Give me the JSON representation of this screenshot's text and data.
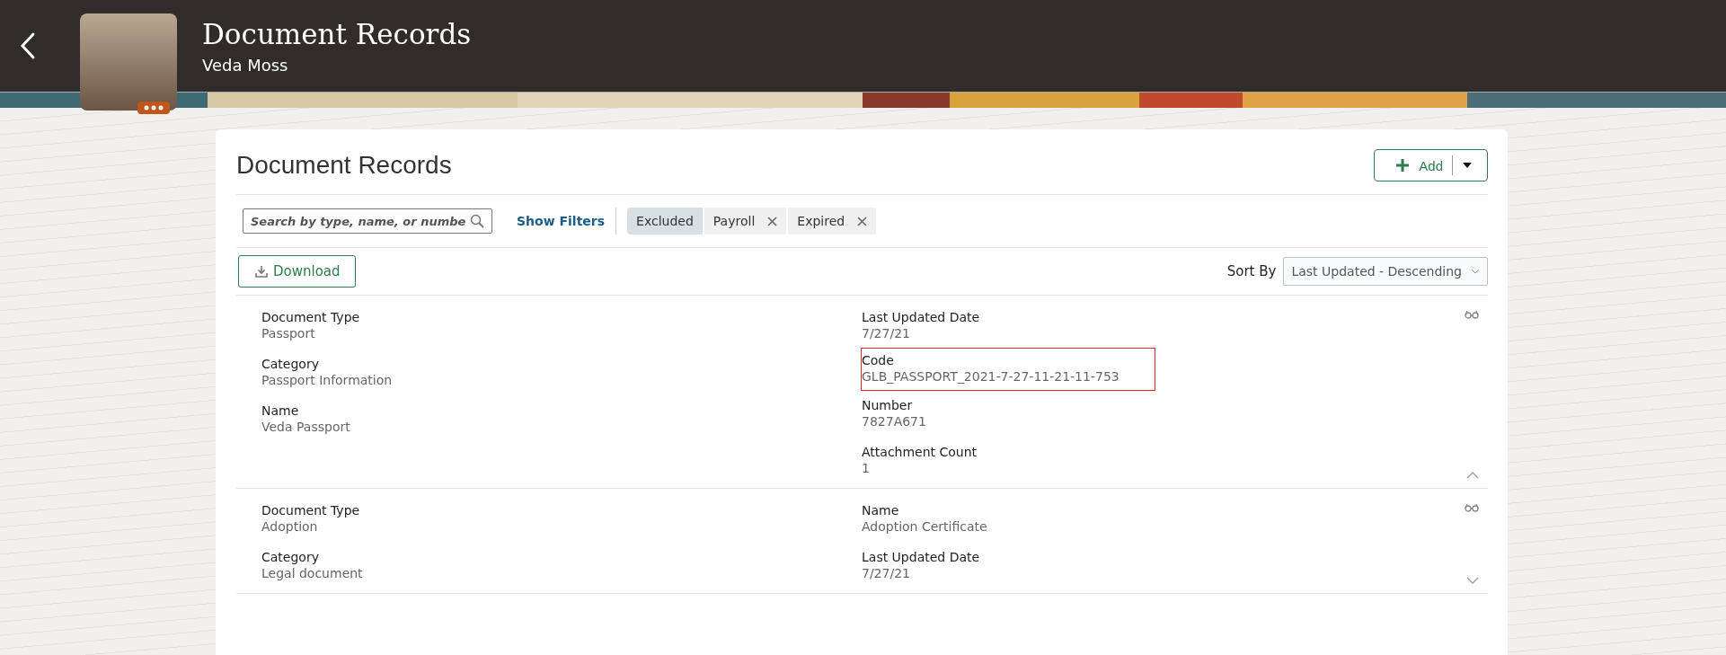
{
  "header": {
    "title": "Document Records",
    "subtitle": "Veda Moss"
  },
  "card": {
    "title": "Document Records",
    "add_button": "Add"
  },
  "search": {
    "placeholder": "Search by type, name, or numbe"
  },
  "show_filters": "Show Filters",
  "filter_chips": [
    {
      "label": "Excluded",
      "kind": "label"
    },
    {
      "label": "Payroll",
      "kind": "removable"
    },
    {
      "label": "Expired",
      "kind": "removable"
    }
  ],
  "download_button": "Download",
  "sort": {
    "label": "Sort By",
    "value": "Last Updated - Descending"
  },
  "records": [
    {
      "expanded": true,
      "left": [
        {
          "label": "Document Type",
          "value": "Passport",
          "highlighted": false
        },
        {
          "label": "Category",
          "value": "Passport Information",
          "highlighted": false
        },
        {
          "label": "Name",
          "value": "Veda Passport",
          "highlighted": false
        }
      ],
      "right": [
        {
          "label": "Last Updated Date",
          "value": "7/27/21",
          "highlighted": false
        },
        {
          "label": "Code",
          "value": "GLB_PASSPORT_2021-7-27-11-21-11-753",
          "highlighted": true
        },
        {
          "label": "Number",
          "value": "7827A671",
          "highlighted": false
        },
        {
          "label": "Attachment Count",
          "value": "1",
          "highlighted": false
        }
      ]
    },
    {
      "expanded": false,
      "left": [
        {
          "label": "Document Type",
          "value": "Adoption",
          "highlighted": false
        },
        {
          "label": "Category",
          "value": "Legal document",
          "highlighted": false
        }
      ],
      "right": [
        {
          "label": "Name",
          "value": "Adoption Certificate",
          "highlighted": false
        },
        {
          "label": "Last Updated Date",
          "value": "7/27/21",
          "highlighted": false
        }
      ]
    }
  ]
}
